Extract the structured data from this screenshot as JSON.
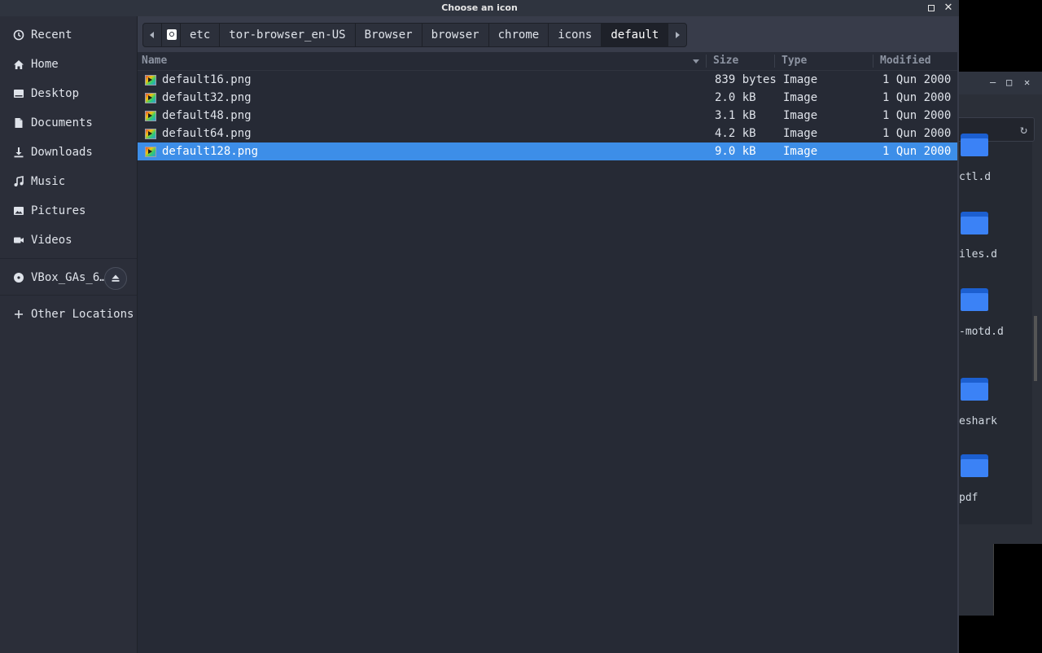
{
  "dialog": {
    "title": "Choose an icon"
  },
  "sidebar": {
    "items": [
      {
        "label": "Recent",
        "icon": "clock-icon"
      },
      {
        "label": "Home",
        "icon": "home-icon"
      },
      {
        "label": "Desktop",
        "icon": "desktop-icon"
      },
      {
        "label": "Documents",
        "icon": "document-icon"
      },
      {
        "label": "Downloads",
        "icon": "download-icon"
      },
      {
        "label": "Music",
        "icon": "music-icon"
      },
      {
        "label": "Pictures",
        "icon": "picture-icon"
      },
      {
        "label": "Videos",
        "icon": "video-icon"
      }
    ],
    "drive": {
      "label": "VBox_GAs_6…",
      "icon": "disc-icon",
      "action_icon": "eject-icon"
    },
    "other": {
      "label": "Other Locations",
      "icon": "plus-icon"
    }
  },
  "pathbar": {
    "crumbs": [
      "etc",
      "tor-browser_en-US",
      "Browser",
      "browser",
      "chrome",
      "icons",
      "default"
    ],
    "active": "default"
  },
  "filelist": {
    "columns": {
      "name": "Name",
      "size": "Size",
      "type": "Type",
      "modified": "Modified"
    },
    "rows": [
      {
        "name": "default16.png",
        "size": "839 bytes",
        "type": "Image",
        "modified": "1 Qun 2000",
        "selected": false
      },
      {
        "name": "default32.png",
        "size": "2.0 kB",
        "type": "Image",
        "modified": "1 Qun 2000",
        "selected": false
      },
      {
        "name": "default48.png",
        "size": "3.1 kB",
        "type": "Image",
        "modified": "1 Qun 2000",
        "selected": false
      },
      {
        "name": "default64.png",
        "size": "4.2 kB",
        "type": "Image",
        "modified": "1 Qun 2000",
        "selected": false
      },
      {
        "name": "default128.png",
        "size": "9.0 kB",
        "type": "Image",
        "modified": "1 Qun 2000",
        "selected": true
      }
    ]
  },
  "background_window": {
    "folders": [
      "ctl.d",
      "iles.d",
      "-motd.d",
      "eshark",
      "pdf"
    ]
  },
  "colors": {
    "selection": "#3d8ee8",
    "folder": "#3b82f6",
    "dialog_bg": "#383c4a"
  }
}
